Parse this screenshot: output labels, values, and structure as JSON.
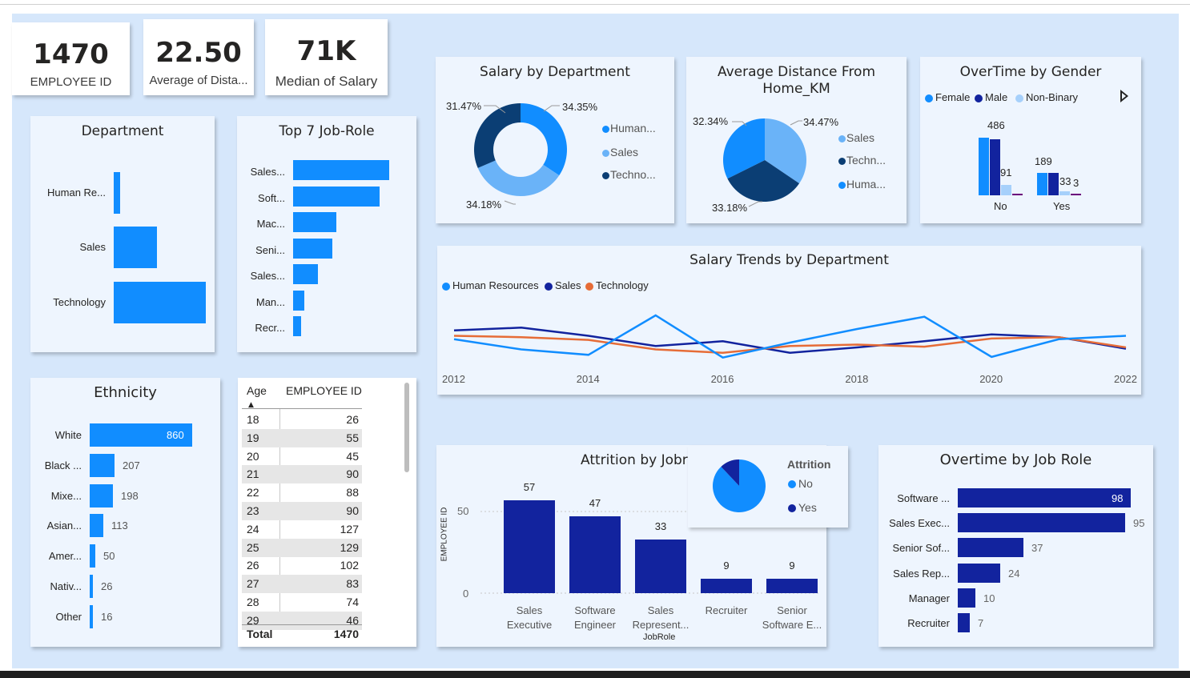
{
  "kpis": [
    {
      "value": "1470",
      "label": "EMPLOYEE ID"
    },
    {
      "value": "22.50",
      "label": "Average of Dista..."
    },
    {
      "value": "71K",
      "label": "Median of Salary"
    }
  ],
  "department": {
    "title": "Department",
    "items": [
      {
        "label": "Human Re...",
        "value": 0.07
      },
      {
        "label": "Sales",
        "value": 0.47
      },
      {
        "label": "Technology",
        "value": 1.0
      }
    ]
  },
  "top_roles": {
    "title": "Top 7 Job-Role",
    "items": [
      {
        "label": "Sales...",
        "value": 1.0
      },
      {
        "label": "Soft...",
        "value": 0.9
      },
      {
        "label": "Mac...",
        "value": 0.45
      },
      {
        "label": "Seni...",
        "value": 0.41
      },
      {
        "label": "Sales...",
        "value": 0.26
      },
      {
        "label": "Man...",
        "value": 0.12
      },
      {
        "label": "Recr...",
        "value": 0.08
      }
    ]
  },
  "ethnicity": {
    "title": "Ethnicity",
    "items": [
      {
        "label": "White",
        "value": 860
      },
      {
        "label": "Black ...",
        "value": 207
      },
      {
        "label": "Mixe...",
        "value": 198
      },
      {
        "label": "Asian...",
        "value": 113
      },
      {
        "label": "Amer...",
        "value": 50
      },
      {
        "label": "Nativ...",
        "value": 26
      },
      {
        "label": "Other",
        "value": 16
      }
    ]
  },
  "age_table": {
    "headers": [
      "Age",
      "EMPLOYEE ID"
    ],
    "rows": [
      [
        "18",
        "26"
      ],
      [
        "19",
        "55"
      ],
      [
        "20",
        "45"
      ],
      [
        "21",
        "90"
      ],
      [
        "22",
        "88"
      ],
      [
        "23",
        "90"
      ],
      [
        "24",
        "127"
      ],
      [
        "25",
        "129"
      ],
      [
        "26",
        "102"
      ],
      [
        "27",
        "83"
      ],
      [
        "28",
        "74"
      ],
      [
        "29",
        "46"
      ]
    ],
    "total_label": "Total",
    "total_value": "1470"
  },
  "salary_by_dept": {
    "title": "Salary by Department",
    "legend": [
      "Human...",
      "Sales",
      "Techno..."
    ],
    "labels": [
      "31.47%",
      "34.35%",
      "34.18%"
    ]
  },
  "avg_distance": {
    "title_line1": "Average Distance From",
    "title_line2": "Home_KM",
    "legend": [
      "Sales",
      "Techn...",
      "Huma..."
    ],
    "labels": [
      "32.34%",
      "34.47%",
      "33.18%"
    ]
  },
  "overtime_gender": {
    "title": "OverTime by Gender",
    "legend": [
      "Female",
      "Male",
      "Non-Binary"
    ],
    "labels": [
      "486",
      "91",
      "189",
      "33",
      "3"
    ],
    "categories": [
      "No",
      "Yes"
    ]
  },
  "salary_trends": {
    "title": "Salary Trends by Department",
    "legend": [
      "Human Resources",
      "Sales",
      "Technology"
    ],
    "x_ticks": [
      "2012",
      "2014",
      "2016",
      "2018",
      "2020",
      "2022"
    ]
  },
  "attrition_jobrole": {
    "title": "Attrition by Jobrole",
    "ylabel": "EMPLOYEE ID",
    "xlabel": "JobRole",
    "y_ticks": [
      "50",
      "0"
    ],
    "bars": [
      {
        "line1": "Sales",
        "line2": "Executive",
        "value": "57"
      },
      {
        "line1": "Software",
        "line2": "Engineer",
        "value": "47"
      },
      {
        "line1": "Sales",
        "line2": "Represent...",
        "value": "33"
      },
      {
        "line1": "Recruiter",
        "line2": "",
        "value": "9"
      },
      {
        "line1": "Senior",
        "line2": "Software E...",
        "value": "9"
      }
    ]
  },
  "attrition_pie": {
    "title": "Attrition",
    "legend": [
      "No",
      "Yes"
    ]
  },
  "overtime_jobrole": {
    "title": "Overtime by Job Role",
    "items": [
      {
        "label": "Software ...",
        "value": "98"
      },
      {
        "label": "Sales Exec...",
        "value": "95"
      },
      {
        "label": "Senior Sof...",
        "value": "37"
      },
      {
        "label": "Sales Rep...",
        "value": "24"
      },
      {
        "label": "Manager",
        "value": "10"
      },
      {
        "label": "Recruiter",
        "value": "7"
      }
    ]
  },
  "chart_data": [
    {
      "type": "bar",
      "title": "Department",
      "categories": [
        "Human Re...",
        "Sales",
        "Technology"
      ],
      "values": [
        0.07,
        0.47,
        1.0
      ]
    },
    {
      "type": "bar",
      "title": "Top 7 Job-Role",
      "categories": [
        "Sales...",
        "Soft...",
        "Mac...",
        "Seni...",
        "Sales...",
        "Man...",
        "Recr..."
      ],
      "values": [
        1.0,
        0.9,
        0.45,
        0.41,
        0.26,
        0.12,
        0.08
      ]
    },
    {
      "type": "bar",
      "title": "Ethnicity",
      "categories": [
        "White",
        "Black ...",
        "Mixe...",
        "Asian...",
        "Amer...",
        "Nativ...",
        "Other"
      ],
      "values": [
        860,
        207,
        198,
        113,
        50,
        26,
        16
      ]
    },
    {
      "type": "pie",
      "title": "Salary by Department",
      "categories": [
        "Human...",
        "Sales",
        "Techno..."
      ],
      "values": [
        34.35,
        34.18,
        31.47
      ]
    },
    {
      "type": "pie",
      "title": "Average Distance From Home_KM",
      "categories": [
        "Sales",
        "Techn...",
        "Huma..."
      ],
      "values": [
        34.47,
        33.18,
        32.34
      ]
    },
    {
      "type": "bar",
      "title": "OverTime by Gender",
      "categories": [
        "No",
        "Yes"
      ],
      "series": [
        {
          "name": "Female",
          "values": [
            486,
            189
          ]
        },
        {
          "name": "Male",
          "values": [
            486,
            189
          ]
        },
        {
          "name": "Non-Binary",
          "values": [
            91,
            33
          ]
        },
        {
          "name": "",
          "values": [
            12,
            3
          ]
        }
      ]
    },
    {
      "type": "line",
      "title": "Salary Trends by Department",
      "x": [
        2012,
        2013,
        2014,
        2015,
        2016,
        2017,
        2018,
        2019,
        2020,
        2021,
        2022
      ],
      "series": [
        {
          "name": "Human Resources",
          "values": [
            0.45,
            0.3,
            0.22,
            0.8,
            0.18,
            0.4,
            0.6,
            0.78,
            0.19,
            0.45,
            0.5
          ]
        },
        {
          "name": "Sales",
          "values": [
            0.58,
            0.62,
            0.5,
            0.35,
            0.42,
            0.25,
            0.33,
            0.42,
            0.52,
            0.48,
            0.31
          ]
        },
        {
          "name": "Technology",
          "values": [
            0.5,
            0.48,
            0.44,
            0.3,
            0.25,
            0.35,
            0.37,
            0.34,
            0.46,
            0.48,
            0.33
          ]
        }
      ]
    },
    {
      "type": "bar",
      "title": "Attrition by Jobrole",
      "categories": [
        "Sales Executive",
        "Software Engineer",
        "Sales Represent...",
        "Recruiter",
        "Senior Software E..."
      ],
      "values": [
        57,
        47,
        33,
        9,
        9
      ],
      "ylabel": "EMPLOYEE ID",
      "xlabel": "JobRole",
      "ylim": [
        0,
        60
      ]
    },
    {
      "type": "pie",
      "title": "Attrition",
      "categories": [
        "No",
        "Yes"
      ],
      "values": [
        0.88,
        0.12
      ]
    },
    {
      "type": "bar",
      "title": "Overtime by Job Role",
      "categories": [
        "Software ...",
        "Sales Exec...",
        "Senior Sof...",
        "Sales Rep...",
        "Manager",
        "Recruiter"
      ],
      "values": [
        98,
        95,
        37,
        24,
        10,
        7
      ]
    }
  ],
  "colors": {
    "canvas": "#d6e7fb",
    "tile": "#eef5fe",
    "blue": "#118dff",
    "navy": "#12239e",
    "darknavy": "#0b3e74",
    "lightblue": "#6ab3f8",
    "paleblue": "#a6d0fb",
    "orange": "#e66c37",
    "purple": "#6b007b"
  }
}
